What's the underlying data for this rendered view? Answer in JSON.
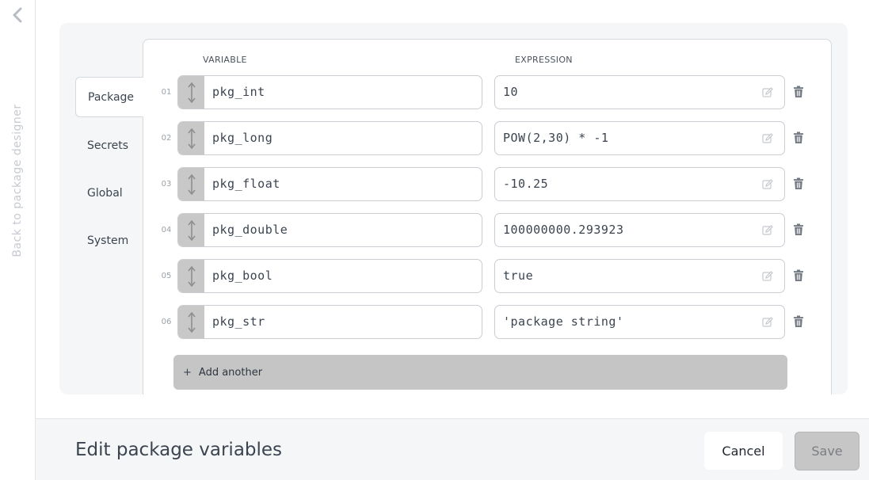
{
  "sidebar": {
    "back_label": "Back to package designer",
    "back_icon": "chevron-left-icon"
  },
  "tabs": [
    {
      "label": "Package",
      "active": true
    },
    {
      "label": "Secrets",
      "active": false
    },
    {
      "label": "Global",
      "active": false
    },
    {
      "label": "System",
      "active": false
    }
  ],
  "columns": {
    "variable": "VARIABLE",
    "expression": "EXPRESSION"
  },
  "rows": [
    {
      "num": "01",
      "variable": "pkg_int",
      "expression": "10"
    },
    {
      "num": "02",
      "variable": "pkg_long",
      "expression": "POW(2,30) * -1"
    },
    {
      "num": "03",
      "variable": "pkg_float",
      "expression": "-10.25"
    },
    {
      "num": "04",
      "variable": "pkg_double",
      "expression": "100000000.293923"
    },
    {
      "num": "05",
      "variable": "pkg_bool",
      "expression": "true"
    },
    {
      "num": "06",
      "variable": "pkg_str",
      "expression": "'package string'"
    }
  ],
  "add_another": {
    "icon": "+",
    "label": "Add another"
  },
  "footer": {
    "title": "Edit package variables",
    "cancel_label": "Cancel",
    "save_label": "Save"
  },
  "colors": {
    "panel_bg": "#f5f6f7",
    "handle_bg": "#c8c8c8",
    "add_btn_bg": "#c5c5c5",
    "save_disabled_bg": "#c6c6c6"
  }
}
